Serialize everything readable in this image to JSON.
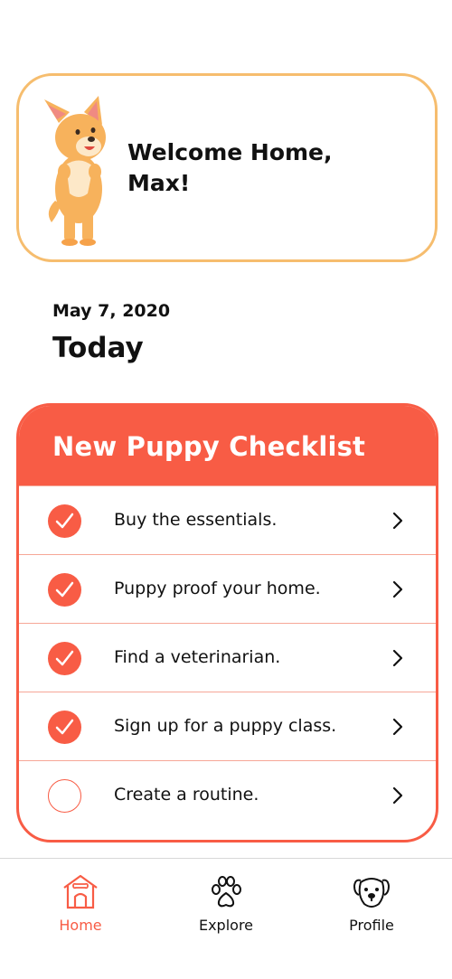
{
  "welcome": {
    "message": "Welcome Home, Max!",
    "mascot_icon": "corgi-mascot-icon"
  },
  "date": "May 7, 2020",
  "section_title": "Today",
  "checklist": {
    "title": "New Puppy Checklist",
    "accent_color": "#f85c45",
    "items": [
      {
        "label": "Buy the essentials.",
        "done": true
      },
      {
        "label": "Puppy proof your home.",
        "done": true
      },
      {
        "label": "Find a veterinarian.",
        "done": true
      },
      {
        "label": "Sign up for a puppy class.",
        "done": true
      },
      {
        "label": "Create a routine.",
        "done": false
      }
    ]
  },
  "nav": {
    "home": {
      "label": "Home",
      "icon": "doghouse-icon",
      "active": true
    },
    "explore": {
      "label": "Explore",
      "icon": "paw-icon"
    },
    "profile": {
      "label": "Profile",
      "icon": "dog-face-icon"
    }
  }
}
